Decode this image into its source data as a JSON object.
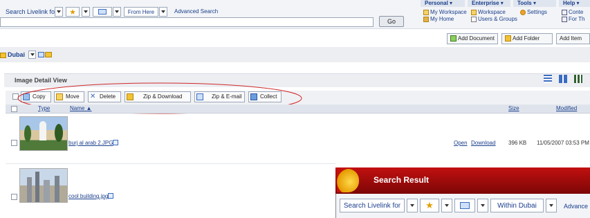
{
  "top": {
    "search_label": "Search Livelink for",
    "scope_value": "From Here",
    "advanced": "Advanced Search",
    "go": "Go",
    "menus": [
      "Personal ▾",
      "Enterprise ▾",
      "Tools ▾",
      "Help ▾"
    ],
    "links": {
      "my_workspace": "My Workspace",
      "my_home": "My Home",
      "workspace": "Workspace",
      "users_groups": "Users & Groups",
      "settings": "Settings",
      "contents": "Conte",
      "for_this": "For Th"
    }
  },
  "actions": {
    "add_document": "Add Document",
    "add_folder": "Add Folder",
    "add_item": "Add Item"
  },
  "folder": {
    "name": "Dubai"
  },
  "panel": {
    "title": "Image Detail View"
  },
  "toolbar": {
    "copy": "Copy",
    "move": "Move",
    "delete": "Delete",
    "zip_download": "Zip & Download",
    "zip_email": "Zip & E-mail",
    "collect": "Collect"
  },
  "columns": {
    "type": "Type",
    "name": "Name ▲",
    "size": "Size",
    "modified": "Modified"
  },
  "rows": [
    {
      "name": "burj al arab 2.JPG",
      "open": "Open",
      "download": "Download",
      "size": "396 KB",
      "modified": "11/05/2007 03:53 PM"
    },
    {
      "name": "cool building.jpg"
    }
  ],
  "search_result": {
    "title": "Search Result",
    "search_label": "Search Livelink for",
    "scope_value": "Within Dubai",
    "advanced": "Advance"
  },
  "colors": {
    "link": "#1a3e8c",
    "header_red": "#c21010",
    "ellipse": "#d0282a"
  }
}
